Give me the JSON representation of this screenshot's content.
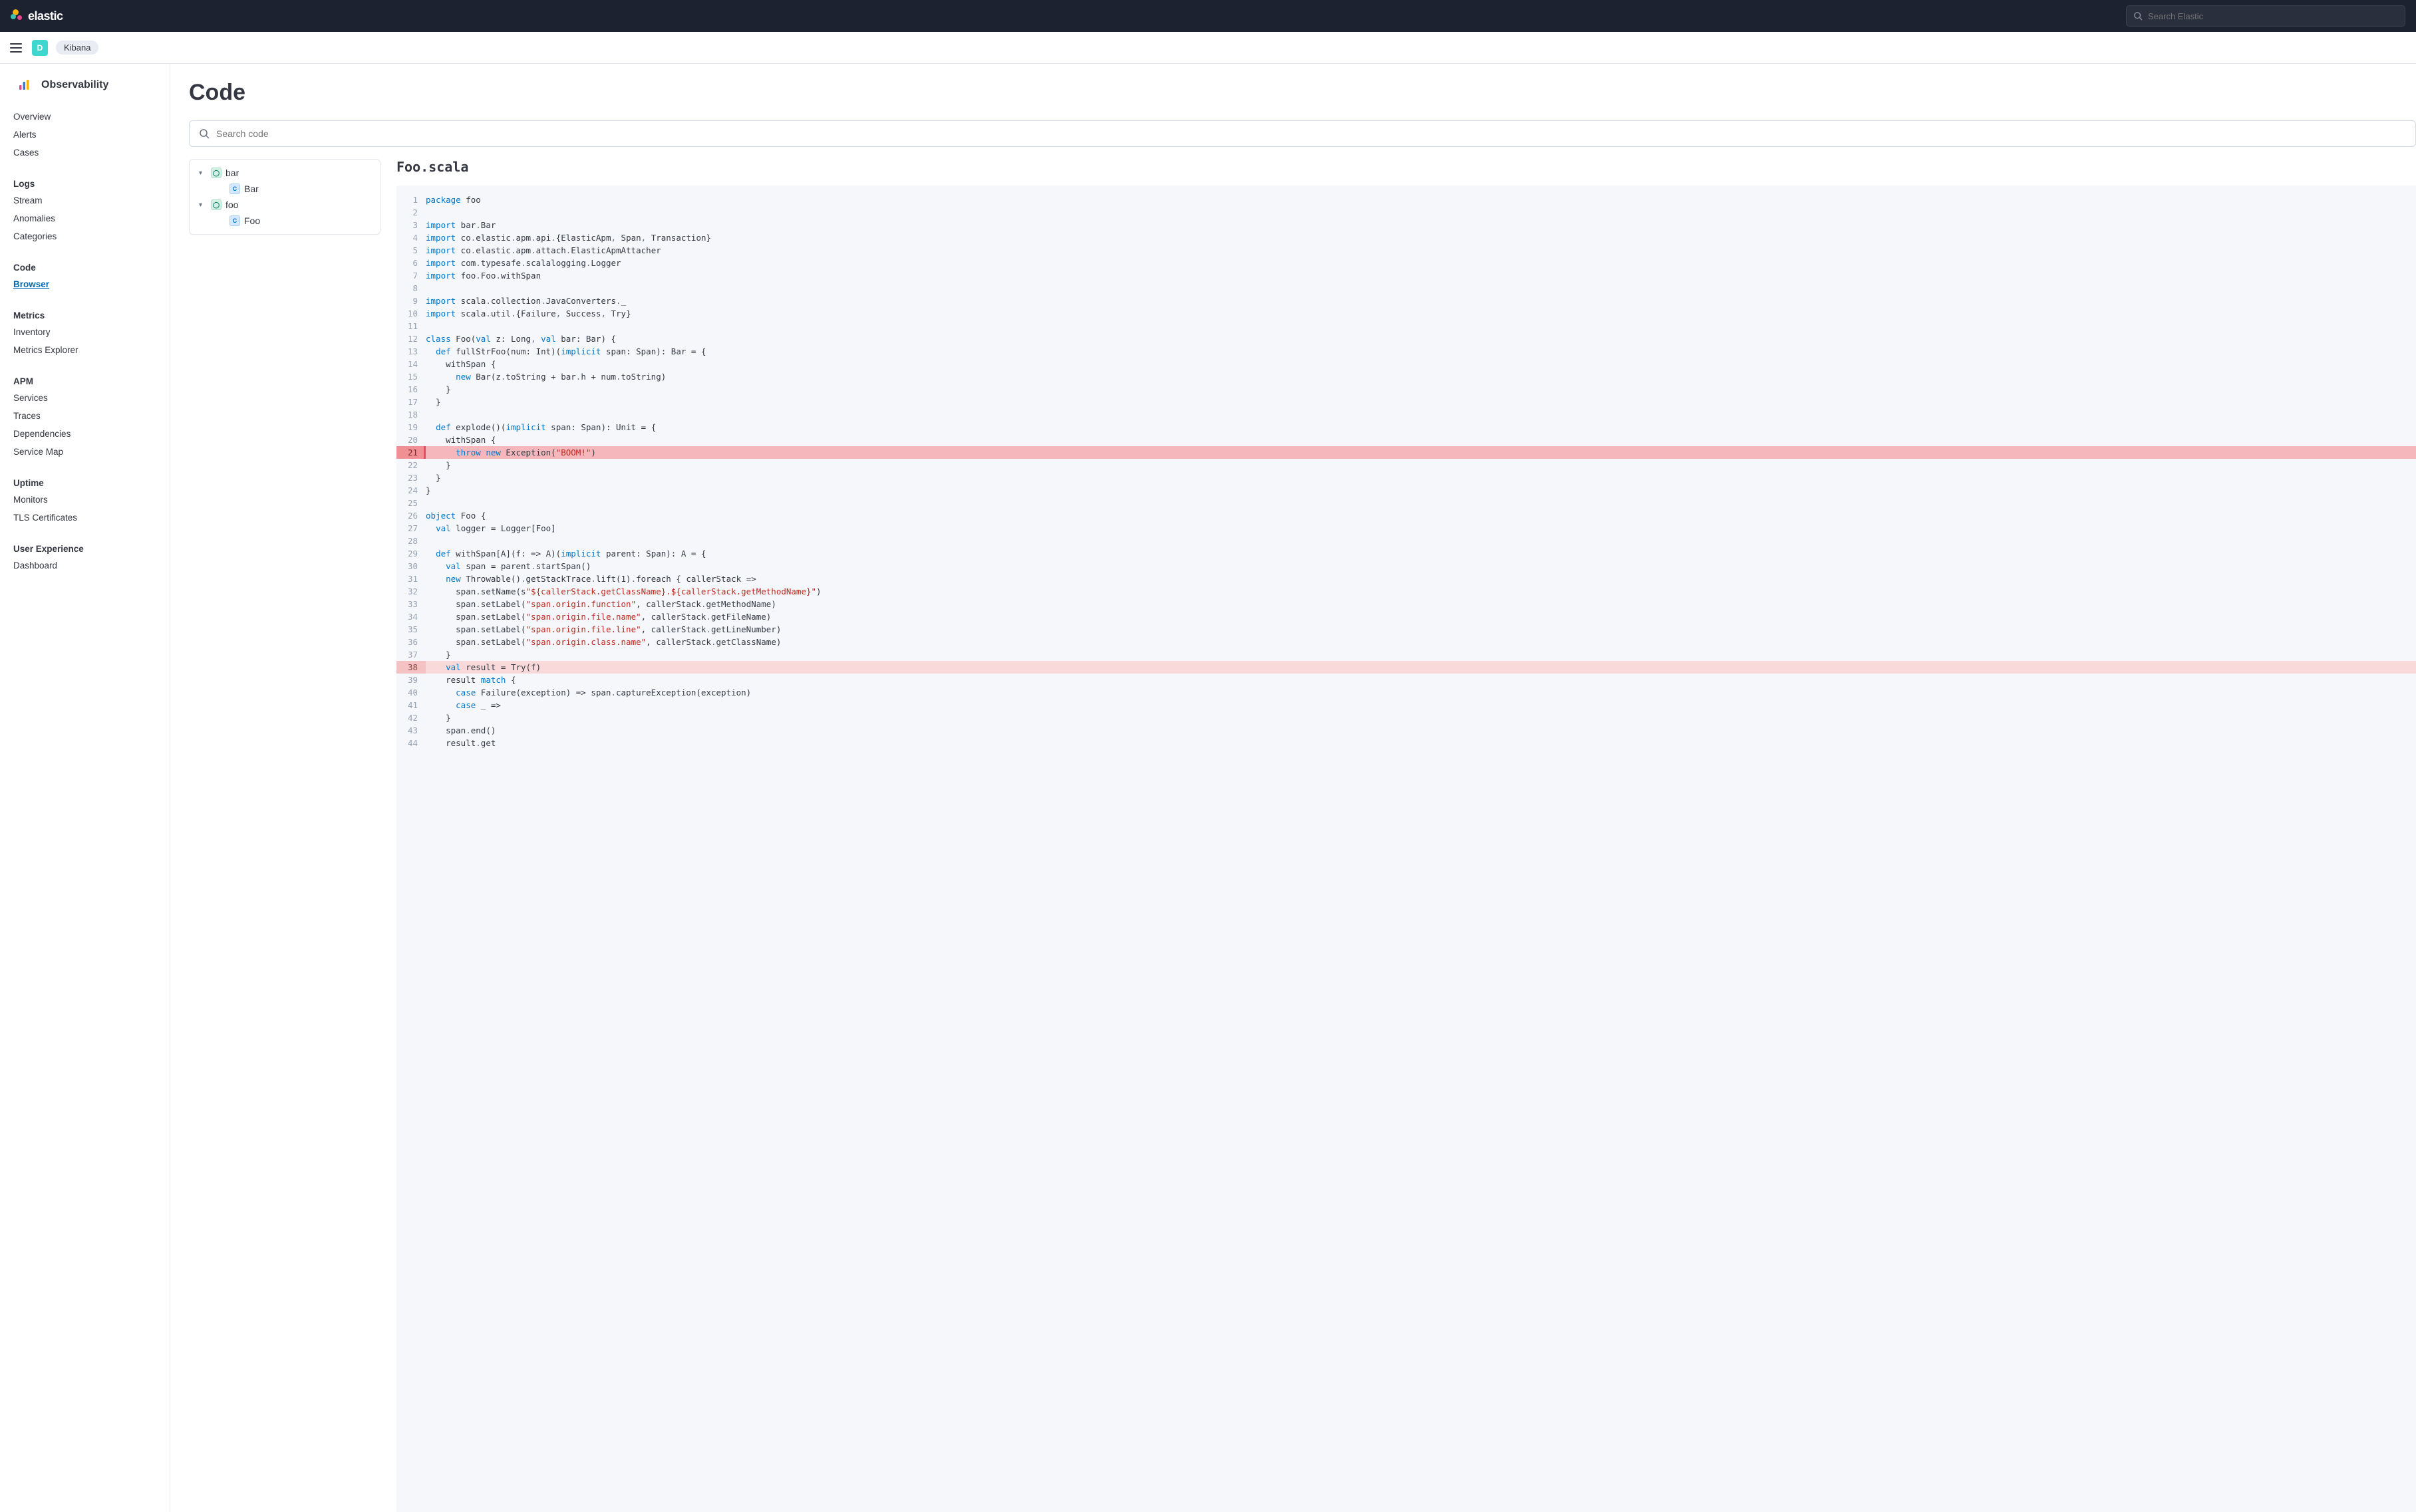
{
  "header": {
    "brand_text": "elastic",
    "search_placeholder": "Search Elastic",
    "avatar_letter": "D",
    "breadcrumb": "Kibana"
  },
  "sidebar": {
    "title": "Observability",
    "top_items": [
      "Overview",
      "Alerts",
      "Cases"
    ],
    "groups": [
      {
        "heading": "Logs",
        "items": [
          "Stream",
          "Anomalies",
          "Categories"
        ]
      },
      {
        "heading": "Code",
        "items": [
          "Browser"
        ],
        "active": "Browser"
      },
      {
        "heading": "Metrics",
        "items": [
          "Inventory",
          "Metrics Explorer"
        ]
      },
      {
        "heading": "APM",
        "items": [
          "Services",
          "Traces",
          "Dependencies",
          "Service Map"
        ]
      },
      {
        "heading": "Uptime",
        "items": [
          "Monitors",
          "TLS Certificates"
        ]
      },
      {
        "heading": "User Experience",
        "items": [
          "Dashboard"
        ]
      }
    ]
  },
  "page": {
    "title": "Code",
    "search_placeholder": "Search code"
  },
  "tree": [
    {
      "type": "pkg",
      "name": "bar",
      "expanded": true,
      "children": [
        {
          "type": "cls",
          "name": "Bar"
        }
      ]
    },
    {
      "type": "pkg",
      "name": "foo",
      "expanded": true,
      "children": [
        {
          "type": "cls",
          "name": "Foo"
        }
      ]
    }
  ],
  "file": {
    "name": "Foo.scala",
    "highlights": {
      "error": [
        21
      ],
      "warn": [
        38
      ]
    },
    "lines": [
      {
        "n": 1,
        "t": [
          [
            "kw",
            "package"
          ],
          [
            "pl",
            " foo"
          ]
        ]
      },
      {
        "n": 2,
        "t": []
      },
      {
        "n": 3,
        "t": [
          [
            "kw",
            "import"
          ],
          [
            "pl",
            " bar"
          ],
          [
            "op",
            "."
          ],
          [
            "pl",
            "Bar"
          ]
        ]
      },
      {
        "n": 4,
        "t": [
          [
            "kw",
            "import"
          ],
          [
            "pl",
            " co"
          ],
          [
            "op",
            "."
          ],
          [
            "pl",
            "elastic"
          ],
          [
            "op",
            "."
          ],
          [
            "pl",
            "apm"
          ],
          [
            "op",
            "."
          ],
          [
            "pl",
            "api"
          ],
          [
            "op",
            "."
          ],
          [
            "pl",
            "{ElasticApm"
          ],
          [
            "op",
            ","
          ],
          [
            "pl",
            " Span"
          ],
          [
            "op",
            ","
          ],
          [
            "pl",
            " Transaction}"
          ]
        ]
      },
      {
        "n": 5,
        "t": [
          [
            "kw",
            "import"
          ],
          [
            "pl",
            " co"
          ],
          [
            "op",
            "."
          ],
          [
            "pl",
            "elastic"
          ],
          [
            "op",
            "."
          ],
          [
            "pl",
            "apm"
          ],
          [
            "op",
            "."
          ],
          [
            "pl",
            "attach"
          ],
          [
            "op",
            "."
          ],
          [
            "pl",
            "ElasticApmAttacher"
          ]
        ]
      },
      {
        "n": 6,
        "t": [
          [
            "kw",
            "import"
          ],
          [
            "pl",
            " com"
          ],
          [
            "op",
            "."
          ],
          [
            "pl",
            "typesafe"
          ],
          [
            "op",
            "."
          ],
          [
            "pl",
            "scalalogging"
          ],
          [
            "op",
            "."
          ],
          [
            "pl",
            "Logger"
          ]
        ]
      },
      {
        "n": 7,
        "t": [
          [
            "kw",
            "import"
          ],
          [
            "pl",
            " foo"
          ],
          [
            "op",
            "."
          ],
          [
            "pl",
            "Foo"
          ],
          [
            "op",
            "."
          ],
          [
            "pl",
            "withSpan"
          ]
        ]
      },
      {
        "n": 8,
        "t": []
      },
      {
        "n": 9,
        "t": [
          [
            "kw",
            "import"
          ],
          [
            "pl",
            " scala"
          ],
          [
            "op",
            "."
          ],
          [
            "pl",
            "collection"
          ],
          [
            "op",
            "."
          ],
          [
            "pl",
            "JavaConverters"
          ],
          [
            "op",
            "."
          ],
          [
            "pl",
            "_"
          ]
        ]
      },
      {
        "n": 10,
        "t": [
          [
            "kw",
            "import"
          ],
          [
            "pl",
            " scala"
          ],
          [
            "op",
            "."
          ],
          [
            "pl",
            "util"
          ],
          [
            "op",
            "."
          ],
          [
            "pl",
            "{Failure"
          ],
          [
            "op",
            ","
          ],
          [
            "pl",
            " Success"
          ],
          [
            "op",
            ","
          ],
          [
            "pl",
            " Try}"
          ]
        ]
      },
      {
        "n": 11,
        "t": []
      },
      {
        "n": 12,
        "t": [
          [
            "kw",
            "class"
          ],
          [
            "pl",
            " Foo("
          ],
          [
            "kw",
            "val"
          ],
          [
            "pl",
            " z: Long"
          ],
          [
            "op",
            ","
          ],
          [
            "pl",
            " "
          ],
          [
            "kw",
            "val"
          ],
          [
            "pl",
            " bar: Bar) {"
          ]
        ]
      },
      {
        "n": 13,
        "t": [
          [
            "pl",
            "  "
          ],
          [
            "kw",
            "def"
          ],
          [
            "pl",
            " fullStrFoo(num: Int)("
          ],
          [
            "kw",
            "implicit"
          ],
          [
            "pl",
            " span: Span): Bar = {"
          ]
        ]
      },
      {
        "n": 14,
        "t": [
          [
            "pl",
            "    withSpan {"
          ]
        ]
      },
      {
        "n": 15,
        "t": [
          [
            "pl",
            "      "
          ],
          [
            "kw",
            "new"
          ],
          [
            "pl",
            " Bar(z"
          ],
          [
            "op",
            "."
          ],
          [
            "pl",
            "toString + bar"
          ],
          [
            "op",
            "."
          ],
          [
            "pl",
            "h + num"
          ],
          [
            "op",
            "."
          ],
          [
            "pl",
            "toString)"
          ]
        ]
      },
      {
        "n": 16,
        "t": [
          [
            "pl",
            "    }"
          ]
        ]
      },
      {
        "n": 17,
        "t": [
          [
            "pl",
            "  }"
          ]
        ]
      },
      {
        "n": 18,
        "t": []
      },
      {
        "n": 19,
        "t": [
          [
            "pl",
            "  "
          ],
          [
            "kw",
            "def"
          ],
          [
            "pl",
            " explode()("
          ],
          [
            "kw",
            "implicit"
          ],
          [
            "pl",
            " span: Span): Unit = {"
          ]
        ]
      },
      {
        "n": 20,
        "t": [
          [
            "pl",
            "    withSpan {"
          ]
        ]
      },
      {
        "n": 21,
        "t": [
          [
            "pl",
            "      "
          ],
          [
            "kw",
            "throw"
          ],
          [
            "pl",
            " "
          ],
          [
            "kw",
            "new"
          ],
          [
            "pl",
            " Exception("
          ],
          [
            "str",
            "\"BOOM!\""
          ],
          [
            "pl",
            ")"
          ]
        ]
      },
      {
        "n": 22,
        "t": [
          [
            "pl",
            "    }"
          ]
        ]
      },
      {
        "n": 23,
        "t": [
          [
            "pl",
            "  }"
          ]
        ]
      },
      {
        "n": 24,
        "t": [
          [
            "pl",
            "}"
          ]
        ]
      },
      {
        "n": 25,
        "t": []
      },
      {
        "n": 26,
        "t": [
          [
            "kw",
            "object"
          ],
          [
            "pl",
            " Foo {"
          ]
        ]
      },
      {
        "n": 27,
        "t": [
          [
            "pl",
            "  "
          ],
          [
            "kw",
            "val"
          ],
          [
            "pl",
            " logger = Logger[Foo]"
          ]
        ]
      },
      {
        "n": 28,
        "t": []
      },
      {
        "n": 29,
        "t": [
          [
            "pl",
            "  "
          ],
          [
            "kw",
            "def"
          ],
          [
            "pl",
            " withSpan[A](f: => A)("
          ],
          [
            "kw",
            "implicit"
          ],
          [
            "pl",
            " parent: Span): A = {"
          ]
        ]
      },
      {
        "n": 30,
        "t": [
          [
            "pl",
            "    "
          ],
          [
            "kw",
            "val"
          ],
          [
            "pl",
            " span = parent"
          ],
          [
            "op",
            "."
          ],
          [
            "pl",
            "startSpan()"
          ]
        ]
      },
      {
        "n": 31,
        "t": [
          [
            "pl",
            "    "
          ],
          [
            "kw",
            "new"
          ],
          [
            "pl",
            " Throwable()"
          ],
          [
            "op",
            "."
          ],
          [
            "pl",
            "getStackTrace"
          ],
          [
            "op",
            "."
          ],
          [
            "pl",
            "lift(1)"
          ],
          [
            "op",
            "."
          ],
          [
            "pl",
            "foreach { callerStack =>"
          ]
        ]
      },
      {
        "n": 32,
        "t": [
          [
            "pl",
            "      span"
          ],
          [
            "op",
            "."
          ],
          [
            "pl",
            "setName(s"
          ],
          [
            "str",
            "\"${callerStack.getClassName}.${callerStack.getMethodName}\""
          ],
          [
            "pl",
            ")"
          ]
        ]
      },
      {
        "n": 33,
        "t": [
          [
            "pl",
            "      span"
          ],
          [
            "op",
            "."
          ],
          [
            "pl",
            "setLabel("
          ],
          [
            "str",
            "\"span.origin.function\""
          ],
          [
            "pl",
            ", callerStack"
          ],
          [
            "op",
            "."
          ],
          [
            "pl",
            "getMethodName)"
          ]
        ]
      },
      {
        "n": 34,
        "t": [
          [
            "pl",
            "      span"
          ],
          [
            "op",
            "."
          ],
          [
            "pl",
            "setLabel("
          ],
          [
            "str",
            "\"span.origin.file.name\""
          ],
          [
            "pl",
            ", callerStack"
          ],
          [
            "op",
            "."
          ],
          [
            "pl",
            "getFileName)"
          ]
        ]
      },
      {
        "n": 35,
        "t": [
          [
            "pl",
            "      span"
          ],
          [
            "op",
            "."
          ],
          [
            "pl",
            "setLabel("
          ],
          [
            "str",
            "\"span.origin.file.line\""
          ],
          [
            "pl",
            ", callerStack"
          ],
          [
            "op",
            "."
          ],
          [
            "pl",
            "getLineNumber)"
          ]
        ]
      },
      {
        "n": 36,
        "t": [
          [
            "pl",
            "      span"
          ],
          [
            "op",
            "."
          ],
          [
            "pl",
            "setLabel("
          ],
          [
            "str",
            "\"span.origin.class.name\""
          ],
          [
            "pl",
            ", callerStack"
          ],
          [
            "op",
            "."
          ],
          [
            "pl",
            "getClassName)"
          ]
        ]
      },
      {
        "n": 37,
        "t": [
          [
            "pl",
            "    }"
          ]
        ]
      },
      {
        "n": 38,
        "t": [
          [
            "pl",
            "    "
          ],
          [
            "kw",
            "val"
          ],
          [
            "pl",
            " result = Try(f)"
          ]
        ]
      },
      {
        "n": 39,
        "t": [
          [
            "pl",
            "    result "
          ],
          [
            "kw",
            "match"
          ],
          [
            "pl",
            " {"
          ]
        ]
      },
      {
        "n": 40,
        "t": [
          [
            "pl",
            "      "
          ],
          [
            "kw",
            "case"
          ],
          [
            "pl",
            " Failure(exception) => span"
          ],
          [
            "op",
            "."
          ],
          [
            "pl",
            "captureException(exception)"
          ]
        ]
      },
      {
        "n": 41,
        "t": [
          [
            "pl",
            "      "
          ],
          [
            "kw",
            "case"
          ],
          [
            "pl",
            " _ =>"
          ]
        ]
      },
      {
        "n": 42,
        "t": [
          [
            "pl",
            "    }"
          ]
        ]
      },
      {
        "n": 43,
        "t": [
          [
            "pl",
            "    span"
          ],
          [
            "op",
            "."
          ],
          [
            "pl",
            "end()"
          ]
        ]
      },
      {
        "n": 44,
        "t": [
          [
            "pl",
            "    result"
          ],
          [
            "op",
            "."
          ],
          [
            "pl",
            "get"
          ]
        ]
      }
    ]
  }
}
